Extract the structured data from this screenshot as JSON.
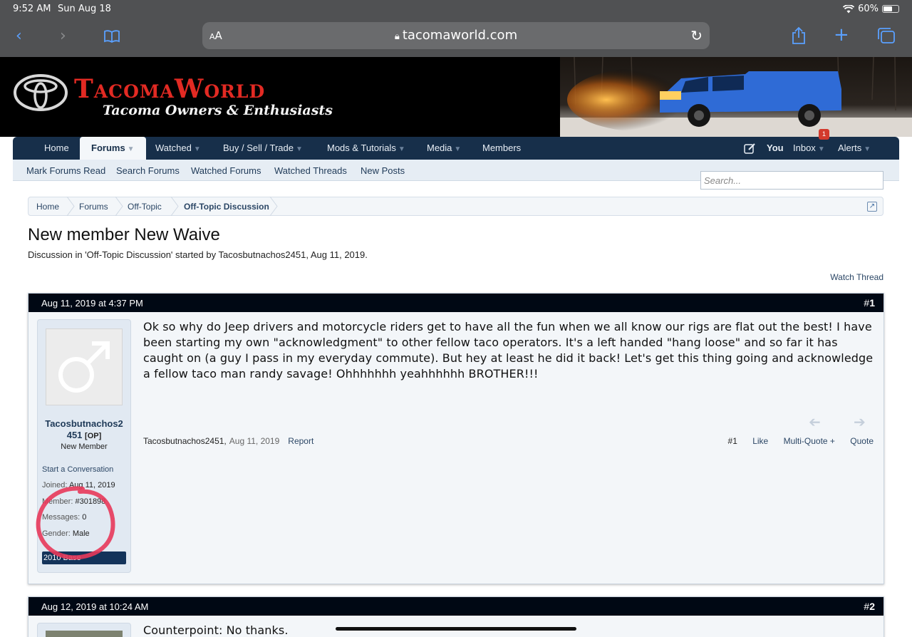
{
  "status": {
    "time": "9:52 AM",
    "date": "Sun Aug 18",
    "battery": "60%",
    "battery_level": 0.6
  },
  "browser": {
    "text_size_label": "AA",
    "host": "tacomaworld.com"
  },
  "brand": {
    "title": "TacomaWorld",
    "subtitle": "Tacoma Owners & Enthusiasts"
  },
  "nav": {
    "home": "Home",
    "forums": "Forums",
    "watched": "Watched",
    "buy_sell": "Buy / Sell / Trade",
    "mods": "Mods & Tutorials",
    "media": "Media",
    "members": "Members",
    "you": "You",
    "inbox": "Inbox",
    "inbox_count": "1",
    "alerts": "Alerts"
  },
  "subnav": {
    "mark_read": "Mark Forums Read",
    "search_forums": "Search Forums",
    "watched_forums": "Watched Forums",
    "watched_threads": "Watched Threads",
    "new_posts": "New Posts",
    "search_placeholder": "Search..."
  },
  "breadcrumb": [
    "Home",
    "Forums",
    "Off-Topic",
    "Off-Topic Discussion"
  ],
  "thread": {
    "title": "New member New Waive",
    "description": "Discussion in 'Off-Topic Discussion' started by Tacosbutnachos2451, Aug 11, 2019.",
    "watch_label": "Watch Thread"
  },
  "posts": [
    {
      "date": "Aug 11, 2019 at 4:37 PM",
      "hash": "#",
      "number": "1",
      "username_line1": "Tacosbutnachos2",
      "username_line2": "451",
      "op_tag": "[OP]",
      "user_title": "New Member",
      "start_conversation": "Start a Conversation",
      "joined_label": "Joined:",
      "joined_value": "Aug 11, 2019",
      "member_label": "Member:",
      "member_value": "#301898",
      "messages_label": "Messages:",
      "messages_value": "0",
      "gender_label": "Gender:",
      "gender_value": "Male",
      "vehicle": "2010 Base",
      "body": "Ok so why do Jeep drivers and motorcycle riders get to have all the fun when we all know our rigs are flat out the best! I have been starting my own \"acknowledgment\" to other fellow taco operators. It's a left handed \"hang loose\" and so far it has caught on (a guy I pass in my everyday commute). But hey at least he did it back! Let's get this thing going and acknowledge a fellow taco man randy savage! Ohhhhhhh yeahhhhhh BROTHER!!!",
      "author": "Tacosbutnachos2451,",
      "author_date": "Aug 11, 2019",
      "report": "Report",
      "footer_num": "#1",
      "like": "Like",
      "multiquote": "Multi-Quote +",
      "quote": "Quote"
    },
    {
      "date": "Aug 12, 2019 at 10:24 AM",
      "hash": "#",
      "number": "2",
      "body": "Counterpoint: No thanks."
    }
  ]
}
